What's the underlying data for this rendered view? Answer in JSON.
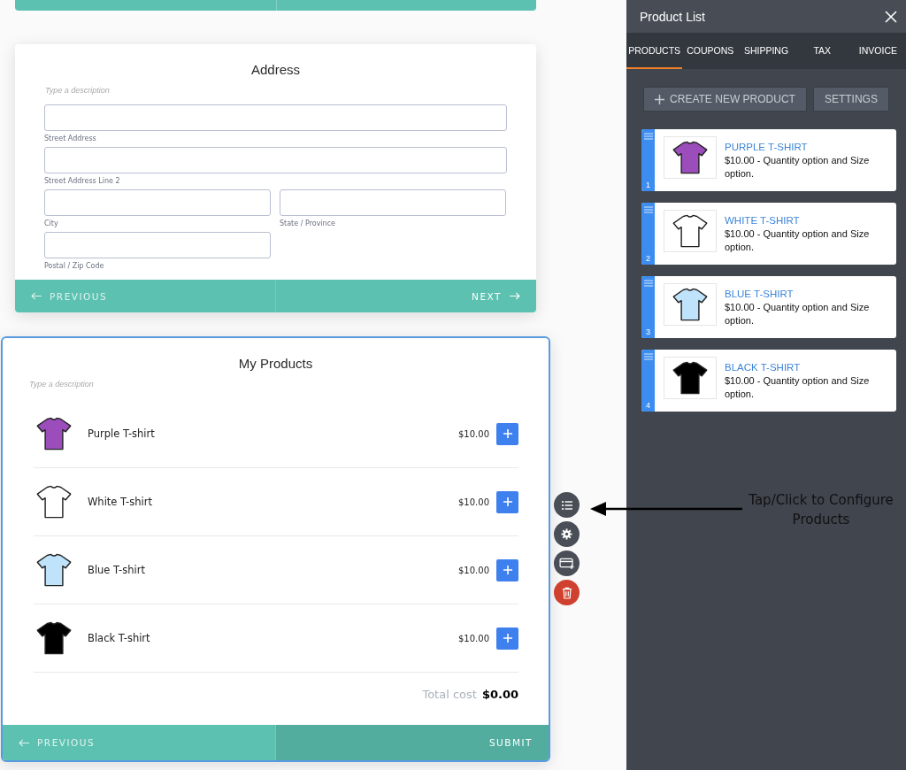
{
  "address_form": {
    "title": "Address",
    "description_placeholder": "Type a description",
    "fields": [
      {
        "label": "Street Address",
        "kind": "full"
      },
      {
        "label": "Street Address Line 2",
        "kind": "full"
      },
      {
        "label": "City",
        "kind": "half"
      },
      {
        "label": "State / Province",
        "kind": "half"
      },
      {
        "label": "Postal / Zip Code",
        "kind": "half"
      }
    ],
    "previous_button": "PREVIOUS",
    "next_button": "NEXT"
  },
  "products_form": {
    "title": "My Products",
    "description_placeholder": "Type a description",
    "products": [
      {
        "name": "Purple T-shirt",
        "price": "$10.00",
        "color": "#9b4dbb"
      },
      {
        "name": "White T-shirt",
        "price": "$10.00",
        "color": "#ffffff"
      },
      {
        "name": "Blue T-shirt",
        "price": "$10.00",
        "color": "#bfe3fa"
      },
      {
        "name": "Black T-shirt",
        "price": "$10.00",
        "color": "#000000"
      }
    ],
    "total_label": "Total cost",
    "total_value": "$0.00",
    "previous_button": "PREVIOUS",
    "submit_button": "SUBMIT"
  },
  "annotation": "Tap/Click to Configure Products",
  "panel": {
    "title": "Product List",
    "tabs": [
      {
        "label": "PRODUCTS",
        "selected": true
      },
      {
        "label": "COUPONS",
        "selected": false
      },
      {
        "label": "SHIPPING",
        "selected": false
      },
      {
        "label": "TAX",
        "selected": false
      },
      {
        "label": "INVOICE",
        "selected": false
      }
    ],
    "create_button": "CREATE NEW PRODUCT",
    "settings_button": "SETTINGS",
    "products": [
      {
        "number": "1",
        "title": "PURPLE T-SHIRT",
        "description": "$10.00 - Quantity option and Size option.",
        "color": "#9b4dbb"
      },
      {
        "number": "2",
        "title": "WHITE T-SHIRT",
        "description": "$10.00 - Quantity option and Size option.",
        "color": "#ffffff"
      },
      {
        "number": "3",
        "title": "BLUE T-SHIRT",
        "description": "$10.00 - Quantity option and Size option.",
        "color": "#bfe3fa"
      },
      {
        "number": "4",
        "title": "BLACK T-SHIRT",
        "description": "$10.00 - Quantity option and Size option.",
        "color": "#000000"
      }
    ]
  }
}
